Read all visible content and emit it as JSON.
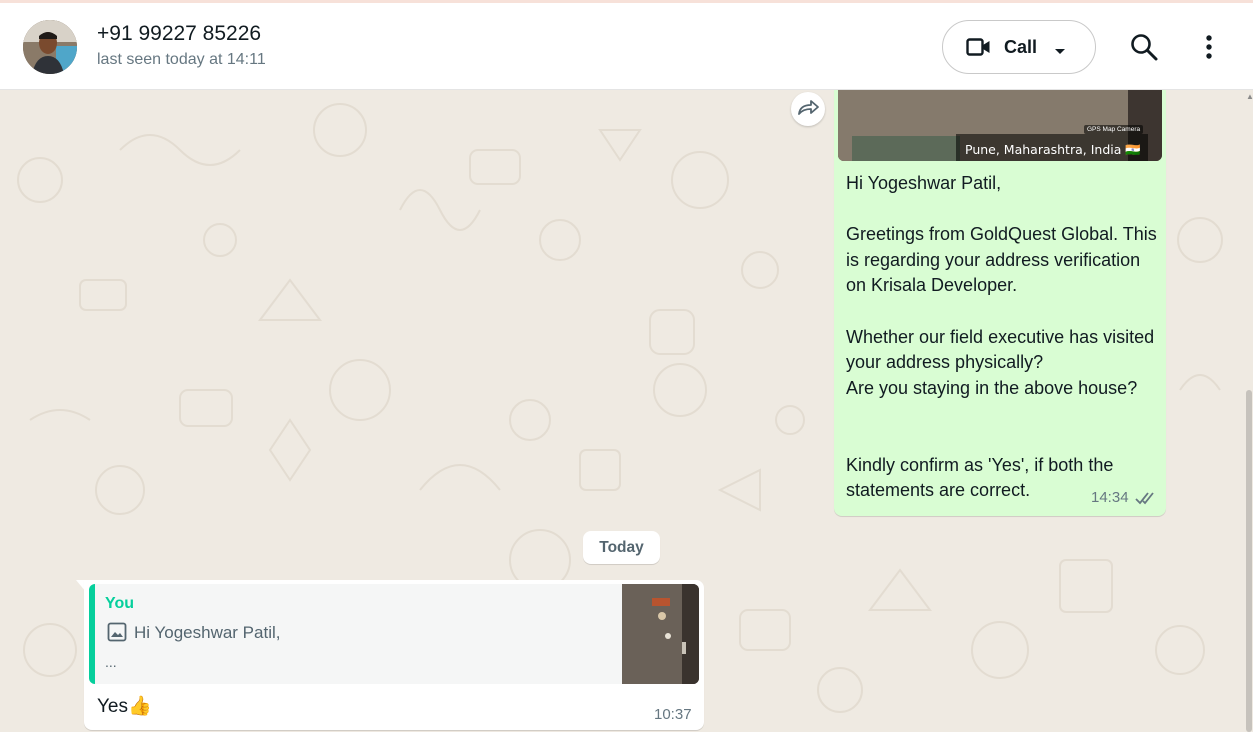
{
  "header": {
    "contact_name": "+91 99227 85226",
    "status": "last seen today at 14:11",
    "call_label": "Call",
    "icons": [
      "video-camera-icon",
      "chevron-down-icon",
      "search-icon",
      "more-vertical-icon"
    ]
  },
  "outgoing": {
    "photo_location": "Pune, Maharashtra, India 🇮🇳",
    "photo_gps": "GPS Map Camera",
    "text": "Hi Yogeshwar Patil,\n\nGreetings from GoldQuest Global. This is regarding your address verification on Krisala Developer.\n\nWhether our field executive has visited your address physically?\nAre you staying in the above house?\n\n\nKindly confirm as 'Yes', if both the statements are correct.",
    "time": "14:34",
    "status_icon": "double-tick-icon"
  },
  "date_chip": "Today",
  "incoming": {
    "quote_author": "You",
    "quote_text": "Hi Yogeshwar Patil,",
    "quote_more": "...",
    "reply_text": "Yes👍",
    "time": "10:37"
  },
  "colors": {
    "chat_bg": "#efeae2",
    "outgoing_bubble": "#d9fdd3",
    "incoming_bubble": "#ffffff",
    "quote_accent": "#06cf9c",
    "secondary_text": "#667781"
  }
}
